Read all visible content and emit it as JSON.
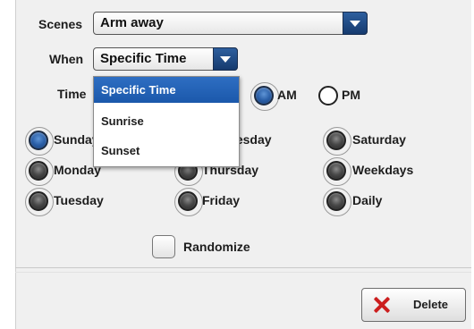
{
  "scenes": {
    "label": "Scenes",
    "value": "Arm away"
  },
  "when": {
    "label": "When",
    "value": "Specific Time",
    "options": [
      "Specific Time",
      "Sunrise",
      "Sunset"
    ]
  },
  "time": {
    "label": "Time",
    "am_label": "AM",
    "pm_label": "PM",
    "selected": "AM"
  },
  "days": {
    "sunday": "Sunday",
    "monday": "Monday",
    "tuesday": "Tuesday",
    "wednesday": "Wednesday",
    "thursday": "Thursday",
    "friday": "Friday",
    "saturday": "Saturday",
    "weekdays": "Weekdays",
    "daily": "Daily",
    "selected": "Sunday"
  },
  "randomize": {
    "label": "Randomize",
    "checked": false
  },
  "delete_button": {
    "label": "Delete"
  },
  "colors": {
    "accent": "#1b58ab",
    "delete_icon": "#cc1f1f"
  },
  "icons": {
    "dropdown": "chevron-down-icon",
    "delete": "close-icon"
  }
}
